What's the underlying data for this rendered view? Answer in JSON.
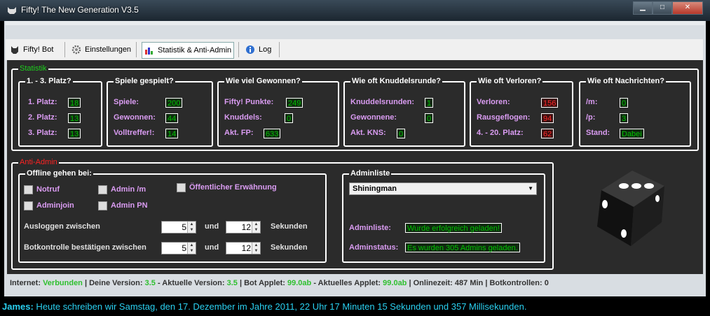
{
  "window": {
    "title": "Fifty! The New Generation V3.5",
    "min": "▁",
    "max": "□",
    "close": "✕"
  },
  "tabs": [
    {
      "label": "Fifty! Bot"
    },
    {
      "label": "Einstellungen"
    },
    {
      "label": "Statistik & Anti-Admin"
    },
    {
      "label": "Log"
    }
  ],
  "statistik": {
    "legend": "Statistik",
    "platz": {
      "title": "1. - 3. Platz?",
      "rows": [
        {
          "label": "1. Platz:",
          "value": "18"
        },
        {
          "label": "2. Platz:",
          "value": "13"
        },
        {
          "label": "3. Platz:",
          "value": "13"
        }
      ]
    },
    "spiele": {
      "title": "Spiele gespielt?",
      "rows": [
        {
          "label": "Spiele:",
          "value": "200"
        },
        {
          "label": "Gewonnen:",
          "value": "44"
        },
        {
          "label": "Volltreffer!:",
          "value": "14"
        }
      ]
    },
    "gewonnen": {
      "title": "Wie viel Gewonnen?",
      "rows": [
        {
          "label": "Fifty! Punkte:",
          "value": "249"
        },
        {
          "label": "Knuddels:",
          "value": "0"
        },
        {
          "label": "Akt. FP:",
          "value": "633"
        }
      ]
    },
    "knuddelsrunde": {
      "title": "Wie oft Knuddelsrunde?",
      "rows": [
        {
          "label": "Knuddelsrunden:",
          "value": "1"
        },
        {
          "label": "Gewonnene:",
          "value": "0"
        },
        {
          "label": "Akt. KNS:",
          "value": "0"
        }
      ]
    },
    "verloren": {
      "title": "Wie oft Verloren?",
      "rows": [
        {
          "label": "Verloren:",
          "value": "156"
        },
        {
          "label": "Rausgeflogen:",
          "value": "94"
        },
        {
          "label": "4. - 20. Platz:",
          "value": "62"
        }
      ]
    },
    "nachrichten": {
      "title": "Wie oft Nachrichten?",
      "rows": [
        {
          "label": "/m:",
          "value": "0"
        },
        {
          "label": "/p:",
          "value": "3"
        },
        {
          "label": "Stand:",
          "value": "Dabei"
        }
      ]
    }
  },
  "antiadmin": {
    "legend": "Anti-Admin",
    "offline": {
      "title": "Offline gehen bei:",
      "notruf": "Notruf",
      "admin_m": "Admin /m",
      "oeffentlich": "Öffentlicher Erwähnung",
      "adminjoin": "Adminjoin",
      "admin_pn": "Admin PN",
      "ausloggen": "Ausloggen zwischen",
      "botkontrolle": "Botkontrolle bestätigen zwischen",
      "und": "und",
      "sekunden": "Sekunden",
      "aus_from": "5",
      "aus_to": "12",
      "bot_from": "5",
      "bot_to": "12"
    },
    "adminliste": {
      "title": "Adminliste",
      "selected": "Shiningman",
      "liste_label": "Adminliste:",
      "liste_value": "Wurde erfolgreich geladen!",
      "status_label": "Adminstatus:",
      "status_value": "Es wurden 305 Admins geladen."
    }
  },
  "statusbar": {
    "internet": "Internet:",
    "internet_v": "Verbunden",
    "version": "Deine Version:",
    "version_v": "3.5",
    "aktuell": "Aktuelle Version:",
    "aktuell_v": "3.5",
    "applet": "Bot Applet:",
    "applet_v": "99.0ab",
    "akt_applet": "Aktuelles Applet:",
    "akt_applet_v": "99.0ab",
    "online": "Onlinezeit:",
    "online_v": "487",
    "min": "Min",
    "botk": "Botkontrollen:",
    "botk_v": "0"
  },
  "chat": {
    "user": "James:",
    "text": " Heute schreiben wir Samstag, den 17. Dezember im Jahre 2011, 22 Uhr 17 Minuten 15 Sekunden und 357 Millisekunden."
  }
}
